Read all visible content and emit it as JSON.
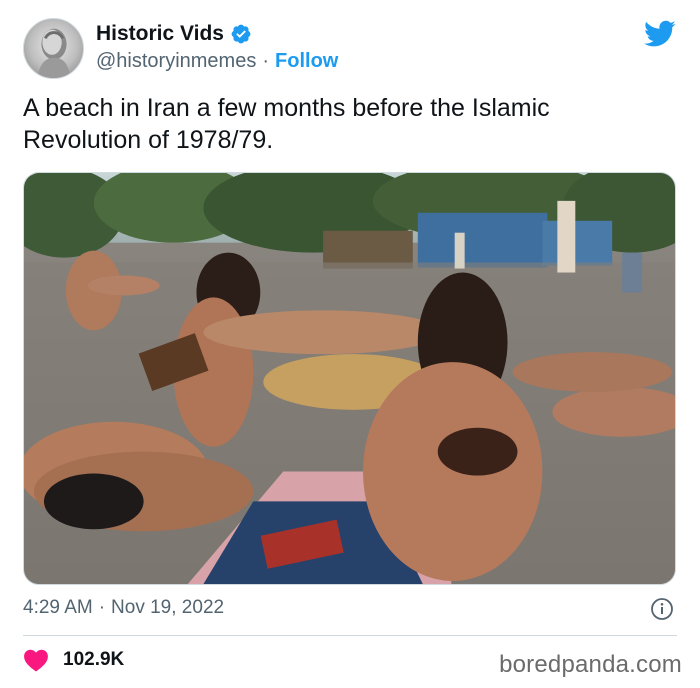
{
  "author": {
    "display_name": "Historic Vids",
    "handle": "@historyinmemes",
    "separator": "·",
    "follow_label": "Follow",
    "verified": true
  },
  "tweet": {
    "text": "A beach in Iran a few months before the Islamic Revolution of 1978/79.",
    "time": "4:29 AM",
    "separator": "·",
    "date": "Nov 19, 2022"
  },
  "engagement": {
    "likes": "102.9K"
  },
  "watermark": "boredpanda.com",
  "colors": {
    "accent": "#1d9bf0",
    "heart": "#f91880",
    "text": "#0f1419",
    "secondary": "#536471"
  },
  "icons": [
    "verified-badge-icon",
    "twitter-bird-icon",
    "info-icon",
    "heart-icon"
  ]
}
